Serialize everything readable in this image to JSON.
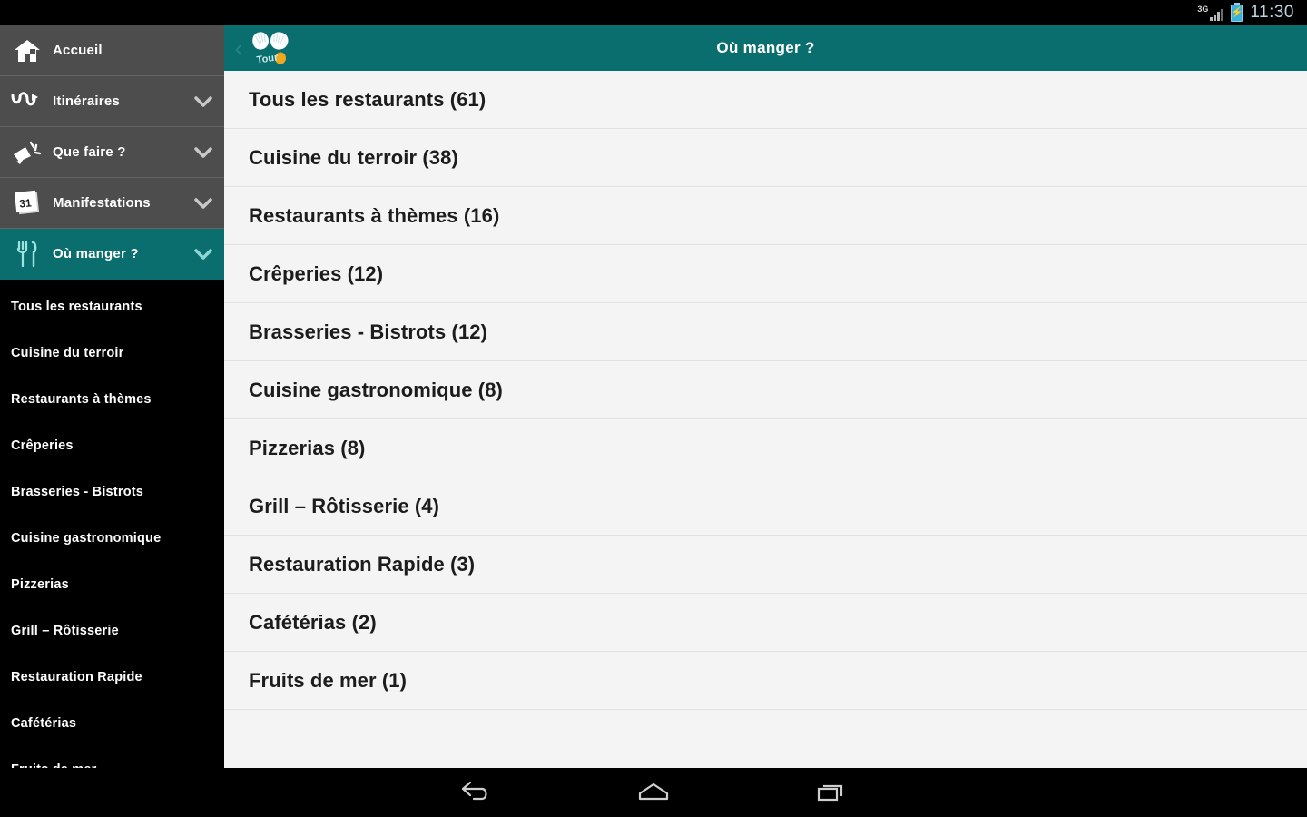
{
  "status_bar": {
    "network_label": "3G",
    "battery_icon": "battery-charging-icon",
    "signal_icon": "signal-bars-icon",
    "time": "11:30"
  },
  "sidebar": {
    "items": [
      {
        "label": "Accueil",
        "icon": "home-icon",
        "expandable": false,
        "active": false
      },
      {
        "label": "Itinéraires",
        "icon": "route-icon",
        "expandable": true,
        "active": false
      },
      {
        "label": "Que faire ?",
        "icon": "megaphone-icon",
        "expandable": true,
        "active": false
      },
      {
        "label": "Manifestations",
        "icon": "calendar-icon",
        "expandable": true,
        "active": false
      },
      {
        "label": "Où manger ?",
        "icon": "cutlery-icon",
        "expandable": true,
        "active": true
      }
    ],
    "submenu": [
      {
        "label": "Tous les restaurants"
      },
      {
        "label": "Cuisine du terroir"
      },
      {
        "label": "Restaurants à thèmes"
      },
      {
        "label": "Crêperies"
      },
      {
        "label": "Brasseries - Bistrots"
      },
      {
        "label": "Cuisine gastronomique"
      },
      {
        "label": "Pizzerias"
      },
      {
        "label": "Grill – Rôtisserie"
      },
      {
        "label": "Restauration Rapide"
      },
      {
        "label": "Cafétérias"
      },
      {
        "label": "Fruits de mer"
      }
    ]
  },
  "appbar": {
    "back_icon": "chevron-left-icon",
    "logo_icon": "shell-logo-icon",
    "logo_text": "Tour",
    "title": "Où manger ?"
  },
  "categories": [
    {
      "label": "Tous les restaurants (61)"
    },
    {
      "label": "Cuisine du terroir (38)"
    },
    {
      "label": "Restaurants à thèmes (16)"
    },
    {
      "label": "Crêperies (12)"
    },
    {
      "label": "Brasseries - Bistrots (12)"
    },
    {
      "label": "Cuisine gastronomique (8)"
    },
    {
      "label": "Pizzerias (8)"
    },
    {
      "label": "Grill – Rôtisserie (4)"
    },
    {
      "label": "Restauration Rapide (3)"
    },
    {
      "label": "Cafétérias (2)"
    },
    {
      "label": "Fruits de mer (1)"
    }
  ],
  "navigation_bar": {
    "back": "back-icon",
    "home": "home-icon",
    "recents": "recents-icon"
  },
  "colors": {
    "accent_teal": "#0a6e6e",
    "sidebar_gray": "#4d4d4d",
    "submenu_black": "#000000",
    "list_bg": "#f4f4f4",
    "divider": "#e2e2e2"
  }
}
